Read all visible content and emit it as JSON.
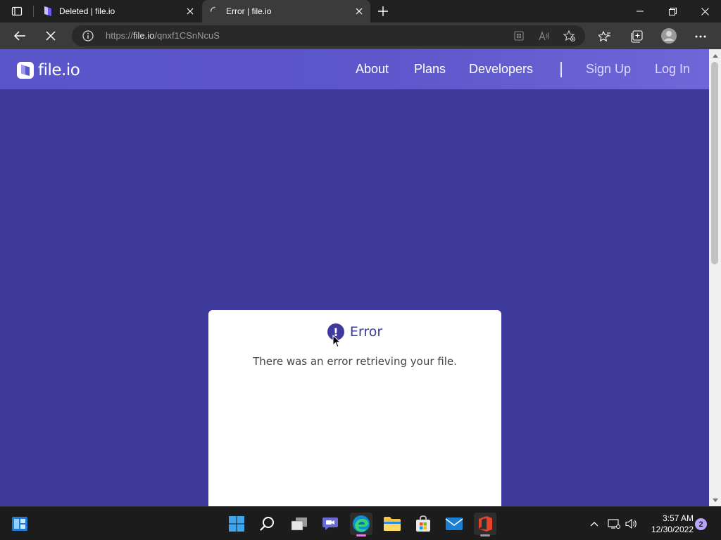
{
  "browser": {
    "tabs": [
      {
        "title": "Deleted | file.io",
        "active": false
      },
      {
        "title": "Error | file.io",
        "active": true,
        "loading": true
      }
    ],
    "url": {
      "scheme": "https://",
      "host": "file.io",
      "path": "/qnxf1CSnNcuS"
    }
  },
  "site": {
    "logo_text": "file.io",
    "nav": [
      "About",
      "Plans",
      "Developers"
    ],
    "auth": [
      "Sign Up",
      "Log In"
    ],
    "brand_color": "#3e3a9b"
  },
  "error_card": {
    "icon_glyph": "!",
    "title": "Error",
    "message": "There was an error retrieving your file."
  },
  "taskbar": {
    "time": "3:57 AM",
    "date": "12/30/2022",
    "notification_count": "2"
  }
}
